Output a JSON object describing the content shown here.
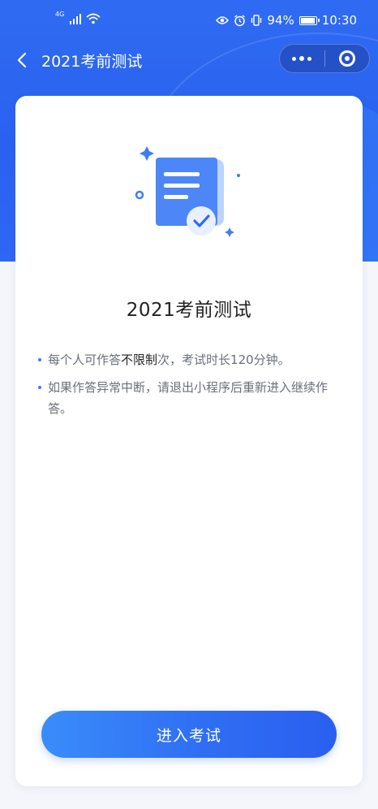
{
  "status_bar": {
    "network": "4G",
    "battery": "94%",
    "time": "10:30"
  },
  "nav": {
    "title": "2021考前测试"
  },
  "card": {
    "title": "2021考前测试",
    "rules": [
      {
        "before": "每个人可作答",
        "strong": "不限制",
        "after": "次，考试时长120分钟。"
      },
      {
        "text": "如果作答异常中断，请退出小程序后重新进入继续作答。"
      }
    ]
  },
  "actions": {
    "enter_label": "进入考试"
  },
  "colors": {
    "brand": "#2f6bf2",
    "bullet": "#3d7bf5",
    "text": "#222222",
    "muted": "#6a6f7a"
  }
}
